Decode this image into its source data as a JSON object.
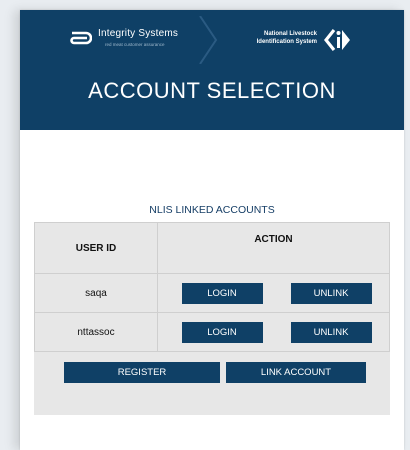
{
  "header": {
    "brand": {
      "name": "Integrity Systems",
      "tagline": "red meat customer assurance",
      "nlis_line1": "National Livestock",
      "nlis_line2": "Identification System"
    },
    "title": "ACCOUNT SELECTION"
  },
  "linked": {
    "title": "NLIS LINKED ACCOUNTS",
    "columns": [
      "USER ID",
      "ACTION"
    ],
    "rows": [
      {
        "user_id": "saqa",
        "login": "LOGIN",
        "unlink": "UNLINK"
      },
      {
        "user_id": "nttassoc",
        "login": "LOGIN",
        "unlink": "UNLINK"
      }
    ]
  },
  "actions": {
    "register": "REGISTER",
    "link_account": "LINK ACCOUNT"
  },
  "colors": {
    "brand_navy": "#0f4066",
    "panel_gray": "#e7e7e7"
  }
}
